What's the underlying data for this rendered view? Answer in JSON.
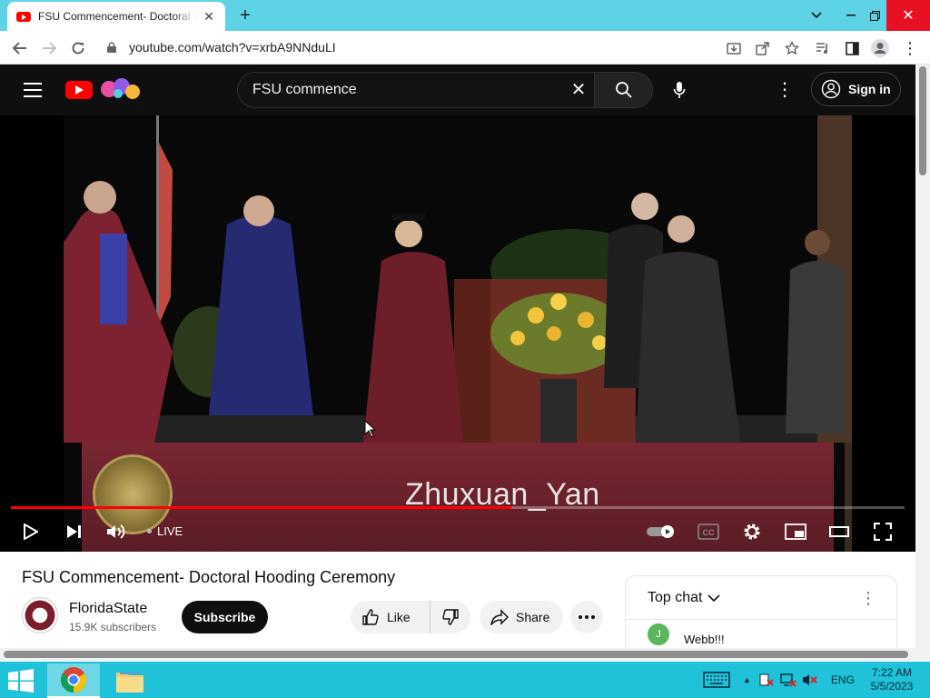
{
  "browser": {
    "tab_title": "FSU Commencement- Doctoral Hooding Ceremony - YouTube",
    "url": "youtube.com/watch?v=xrbA9NNduLI"
  },
  "youtube": {
    "search_value": "FSU commence",
    "sign_in": "Sign in"
  },
  "player": {
    "overlay_name": "Zhuxuan_Yan",
    "live_label": "LIVE",
    "progress": 0.56
  },
  "video": {
    "title": "FSU Commencement- Doctoral Hooding Ceremony",
    "channel": "FloridaState",
    "subscribers": "15.9K subscribers",
    "subscribe_label": "Subscribe",
    "like_label": "Like",
    "share_label": "Share"
  },
  "chat": {
    "mode": "Top chat",
    "avatar_letter": "J",
    "message": "Webb!!!"
  },
  "taskbar": {
    "language": "ENG",
    "time": "7:22 AM",
    "date": "5/5/2023"
  },
  "colors": {
    "titlebar": "#5ed3e6",
    "youtube_red": "#ff0000",
    "masthead": "#0f0f0f",
    "fsu_garnet": "#7a2632",
    "taskbar": "#1fc2d8"
  },
  "icons": [
    "youtube-favicon",
    "close-icon",
    "plus-icon",
    "back-icon",
    "forward-icon",
    "reload-icon",
    "lock-icon",
    "install-icon",
    "share-page-icon",
    "star-icon",
    "media-icon",
    "sidepanel-icon",
    "profile-icon",
    "menu-icon",
    "search-icon",
    "mic-icon",
    "more-vert-icon",
    "account-icon",
    "play-icon",
    "next-icon",
    "volume-icon",
    "autoplay-toggle",
    "cc-icon",
    "settings-icon",
    "miniplayer-icon",
    "theater-icon",
    "fullscreen-icon",
    "thumb-up-icon",
    "thumb-down-icon",
    "share-icon",
    "more-horiz-icon",
    "chevron-down-icon"
  ]
}
